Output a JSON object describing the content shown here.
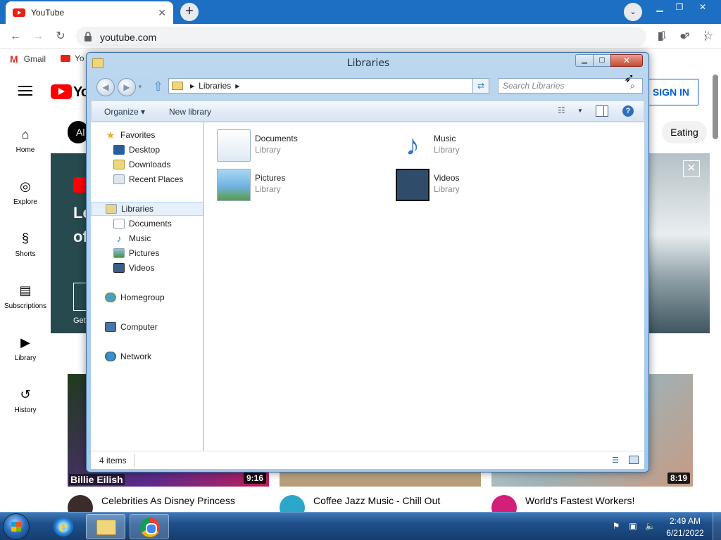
{
  "chrome": {
    "tab_title": "YouTube",
    "tab_close": "✕",
    "new_tab": "+",
    "tab_search": "⌄",
    "url": "youtube.com",
    "bookmarks": [
      {
        "label": "Gmail"
      },
      {
        "label": "Yo"
      }
    ]
  },
  "youtube": {
    "logo_text": "Yo",
    "signin_label": "SIGN IN",
    "chip_all": "Al",
    "chip_eating": "Eating",
    "nav": [
      {
        "label": "Home",
        "icon": "⌂"
      },
      {
        "label": "Explore",
        "icon": "◎"
      },
      {
        "label": "Shorts",
        "icon": "§"
      },
      {
        "label": "Subscriptions",
        "icon": "▤"
      },
      {
        "label": "Library",
        "icon": "▶"
      },
      {
        "label": "History",
        "icon": "↺"
      }
    ],
    "banner": {
      "line1": "Le",
      "line2": "of",
      "get": "Get",
      "close": "✕"
    },
    "videos": [
      {
        "title": "Celebrities As Disney Princess",
        "duration": "9:16",
        "overlay": "Billie Eilish"
      },
      {
        "title": "Coffee Jazz Music - Chill Out",
        "duration": ""
      },
      {
        "title": "World's Fastest Workers!",
        "duration": "8:19"
      }
    ]
  },
  "explorer": {
    "title": "Libraries",
    "address_crumb": "Libraries",
    "search_placeholder": "Search Libraries",
    "commands": {
      "organize": "Organize ▾",
      "new_library": "New library"
    },
    "nav_pane": {
      "favorites": "Favorites",
      "favorites_items": [
        "Desktop",
        "Downloads",
        "Recent Places"
      ],
      "libraries": "Libraries",
      "libraries_items": [
        "Documents",
        "Music",
        "Pictures",
        "Videos"
      ],
      "homegroup": "Homegroup",
      "computer": "Computer",
      "network": "Network"
    },
    "libraries": [
      {
        "name": "Documents",
        "type": "Library"
      },
      {
        "name": "Music",
        "type": "Library"
      },
      {
        "name": "Pictures",
        "type": "Library"
      },
      {
        "name": "Videos",
        "type": "Library"
      }
    ],
    "status_count": "4 items",
    "ctrl": {
      "min": "▁",
      "max": "▢",
      "close": "✕"
    }
  },
  "taskbar": {
    "clock_time": "2:49 AM",
    "clock_date": "6/21/2022",
    "ie_glyph": "e"
  }
}
